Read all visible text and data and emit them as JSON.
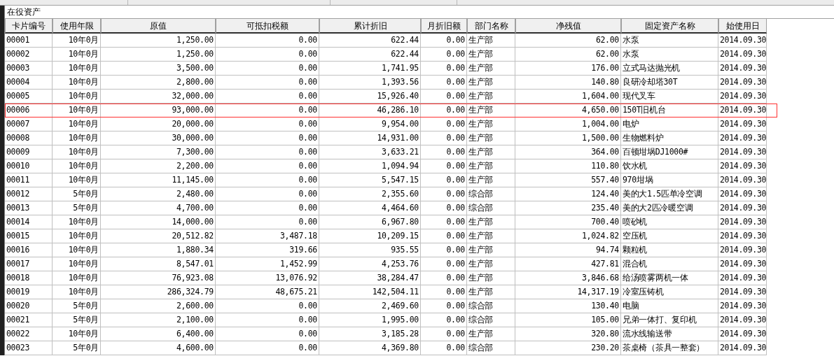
{
  "panel": {
    "title": "在役资产"
  },
  "table": {
    "columns": [
      "卡片编号",
      "使用年限",
      "原值",
      "可抵扣税额",
      "累计折旧",
      "月折旧额",
      "部门名称",
      "净残值",
      "固定资产名称",
      "始使用日"
    ],
    "rows": [
      {
        "selected": false,
        "cells": [
          "00001",
          "10年0月",
          "1,250.00",
          "0.00",
          "622.44",
          "0.00",
          "生产部",
          "62.00",
          "水泵",
          "2014.09.30"
        ]
      },
      {
        "selected": false,
        "cells": [
          "00002",
          "10年0月",
          "1,250.00",
          "0.00",
          "622.44",
          "0.00",
          "生产部",
          "62.00",
          "水泵",
          "2014.09.30"
        ]
      },
      {
        "selected": false,
        "cells": [
          "00003",
          "10年0月",
          "3,500.00",
          "0.00",
          "1,741.95",
          "0.00",
          "生产部",
          "176.00",
          "立式马达抛光机",
          "2014.09.30"
        ]
      },
      {
        "selected": false,
        "cells": [
          "00004",
          "10年0月",
          "2,800.00",
          "0.00",
          "1,393.56",
          "0.00",
          "生产部",
          "140.80",
          "良研冷却塔30T",
          "2014.09.30"
        ]
      },
      {
        "selected": false,
        "cells": [
          "00005",
          "10年0月",
          "32,000.00",
          "0.00",
          "15,926.40",
          "0.00",
          "生产部",
          "1,604.00",
          "现代叉车",
          "2014.09.30"
        ]
      },
      {
        "selected": true,
        "cells": [
          "00006",
          "10年0月",
          "93,000.00",
          "0.00",
          "46,286.10",
          "0.00",
          "生产部",
          "4,650.00",
          "150T旧机台",
          "2014.09.30"
        ]
      },
      {
        "selected": false,
        "cells": [
          "00007",
          "10年0月",
          "20,000.00",
          "0.00",
          "9,954.00",
          "0.00",
          "生产部",
          "1,004.00",
          "电炉",
          "2014.09.30"
        ]
      },
      {
        "selected": false,
        "cells": [
          "00008",
          "10年0月",
          "30,000.00",
          "0.00",
          "14,931.00",
          "0.00",
          "生产部",
          "1,500.00",
          "生物燃料炉",
          "2014.09.30"
        ]
      },
      {
        "selected": false,
        "cells": [
          "00009",
          "10年0月",
          "7,300.00",
          "0.00",
          "3,633.21",
          "0.00",
          "生产部",
          "364.00",
          "百顿坩埚DJ1000#",
          "2014.09.30"
        ]
      },
      {
        "selected": false,
        "cells": [
          "00010",
          "10年0月",
          "2,200.00",
          "0.00",
          "1,094.94",
          "0.00",
          "生产部",
          "110.80",
          "饮水机",
          "2014.09.30"
        ]
      },
      {
        "selected": false,
        "cells": [
          "00011",
          "10年0月",
          "11,145.00",
          "0.00",
          "5,547.15",
          "0.00",
          "生产部",
          "557.40",
          "970坩埚",
          "2014.09.30"
        ]
      },
      {
        "selected": false,
        "cells": [
          "00012",
          "5年0月",
          "2,480.00",
          "0.00",
          "2,355.60",
          "0.00",
          "综合部",
          "124.40",
          "美的大1.5匹单冷空调",
          "2014.09.30"
        ]
      },
      {
        "selected": false,
        "cells": [
          "00013",
          "5年0月",
          "4,700.00",
          "0.00",
          "4,464.60",
          "0.00",
          "综合部",
          "235.40",
          "美的大2匹冷暖空调",
          "2014.09.30"
        ]
      },
      {
        "selected": false,
        "cells": [
          "00014",
          "10年0月",
          "14,000.00",
          "0.00",
          "6,967.80",
          "0.00",
          "生产部",
          "700.40",
          "喷砂机",
          "2014.09.30"
        ]
      },
      {
        "selected": false,
        "cells": [
          "00015",
          "10年0月",
          "20,512.82",
          "3,487.18",
          "10,209.15",
          "0.00",
          "生产部",
          "1,024.82",
          "空压机",
          "2014.09.30"
        ]
      },
      {
        "selected": false,
        "cells": [
          "00016",
          "10年0月",
          "1,880.34",
          "319.66",
          "935.55",
          "0.00",
          "生产部",
          "94.74",
          "颗粒机",
          "2014.09.30"
        ]
      },
      {
        "selected": false,
        "cells": [
          "00017",
          "10年0月",
          "8,547.01",
          "1,452.99",
          "4,253.76",
          "0.00",
          "生产部",
          "427.81",
          "混合机",
          "2014.09.30"
        ]
      },
      {
        "selected": false,
        "cells": [
          "00018",
          "10年0月",
          "76,923.08",
          "13,076.92",
          "38,284.47",
          "0.00",
          "生产部",
          "3,846.68",
          "给汤喷雾两机一体",
          "2014.09.30"
        ]
      },
      {
        "selected": false,
        "cells": [
          "00019",
          "10年0月",
          "286,324.79",
          "48,675.21",
          "142,504.11",
          "0.00",
          "生产部",
          "14,317.19",
          "冷室压铸机",
          "2014.09.30"
        ]
      },
      {
        "selected": false,
        "cells": [
          "00020",
          "5年0月",
          "2,600.00",
          "0.00",
          "2,469.60",
          "0.00",
          "综合部",
          "130.40",
          "电脑",
          "2014.09.30"
        ]
      },
      {
        "selected": false,
        "cells": [
          "00021",
          "5年0月",
          "2,100.00",
          "0.00",
          "1,995.00",
          "0.00",
          "综合部",
          "105.00",
          "兄弟一体打、复印机",
          "2014.09.30"
        ]
      },
      {
        "selected": false,
        "cells": [
          "00022",
          "10年0月",
          "6,400.00",
          "0.00",
          "3,185.28",
          "0.00",
          "生产部",
          "320.80",
          "流水线输送带",
          "2014.09.30"
        ]
      },
      {
        "selected": false,
        "cells": [
          "00023",
          "5年0月",
          "4,600.00",
          "0.00",
          "4,369.80",
          "0.00",
          "综合部",
          "230.20",
          "茶桌椅（茶具一整套）",
          "2014.09.30"
        ]
      }
    ]
  }
}
